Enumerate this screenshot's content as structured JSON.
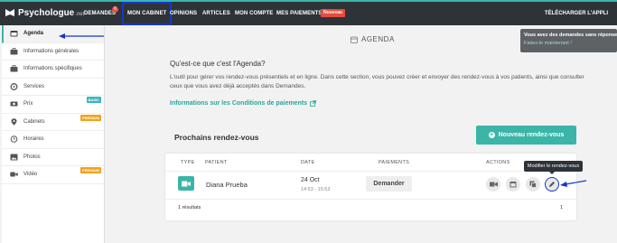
{
  "app": {
    "logo_text": "Psychologue",
    "logo_sub": ".net"
  },
  "nav": {
    "demandes": "DEMANDES",
    "demandes_count": "6",
    "mon_cabinet": "MON CABINET",
    "opinions": "OPINIONS",
    "articles": "ARTICLES",
    "mon_compte": "MON COMPTE",
    "mes_paiements": "MES PAIEMENTS",
    "nouveau_badge": "Nouveau",
    "download": "TÉLÉCHARGER L'APPLI"
  },
  "sidebar": {
    "items": [
      {
        "label": "Agenda",
        "icon": "calendar-icon"
      },
      {
        "label": "Informations générales",
        "icon": "briefcase-icon"
      },
      {
        "label": "Informations spécifiques",
        "icon": "briefcase-icon"
      },
      {
        "label": "Services",
        "icon": "gear-icon"
      },
      {
        "label": "Prix",
        "icon": "money-icon",
        "badge": "BASIC"
      },
      {
        "label": "Cabinets",
        "icon": "map-pin-icon",
        "badge": "PREMIUM"
      },
      {
        "label": "Horaires",
        "icon": "clock-icon"
      },
      {
        "label": "Photos",
        "icon": "image-icon"
      },
      {
        "label": "Vidéo",
        "icon": "video-icon",
        "badge": "PREMIUM"
      }
    ]
  },
  "main": {
    "section_title": "AGENDA",
    "intro_question": "Qu'est-ce que c'est l'Agenda?",
    "intro_text": "L'outil pour gérer vos rendez-vous présentiels et en ligne. Dans cette section, vous pouvez créer et envoyer des rendez-vous à vos patients, ainsi que consulter ceux que vous avez déjà acceptés dans Demandes.",
    "info_link": "Informations sur les Conditions de paiements",
    "upcoming_title": "Prochains rendez-vous",
    "new_button": "Nouveau rendez-vous"
  },
  "table": {
    "headers": {
      "type": "TYPE",
      "patient": "PATIENT",
      "date": "DATE",
      "paiements": "PAIEMENTS",
      "actions": "ACTIONS"
    },
    "rows": [
      {
        "patient": "Diana Prueba",
        "date": "24 Oct",
        "time": "14:53 - 15:53",
        "payment_button": "Demander"
      }
    ],
    "results_text": "1 résultats",
    "page": "1"
  },
  "tooltip": "Modifier le rendez-vous",
  "notice": {
    "text": "Vous avez des demandes sans réponse",
    "link": "Faites-le maintenant !"
  },
  "colors": {
    "accent": "#3ab5a8",
    "topbar": "#2e3338",
    "badge_red": "#e74c3c",
    "badge_basic": "#3bb4c1",
    "badge_premium": "#f1a21b",
    "annotation_blue": "#1537c9"
  }
}
